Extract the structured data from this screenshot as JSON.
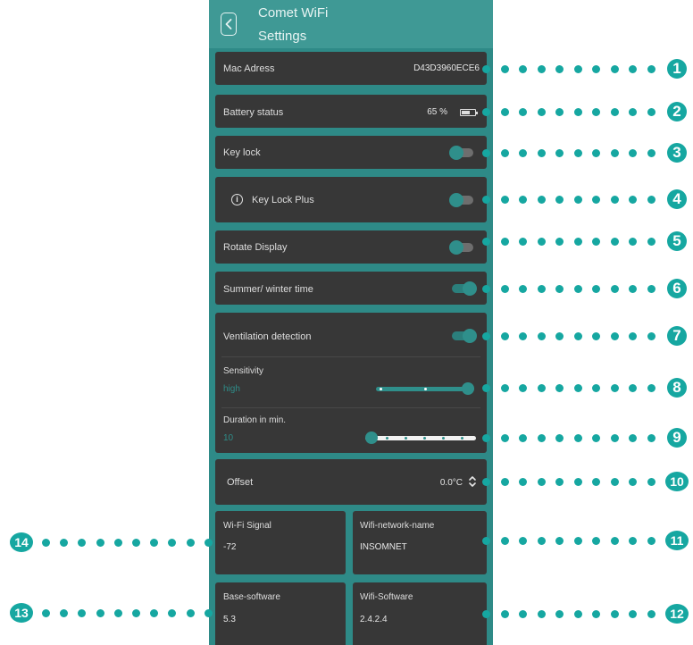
{
  "header": {
    "title_line1": "Comet WiFi",
    "title_line2": "Settings",
    "back_icon": "chevron-left-icon"
  },
  "mac": {
    "label": "Mac Adress",
    "value": "D43D3960ECE6"
  },
  "battery": {
    "label": "Battery status",
    "value": "65 %",
    "level_percent": 65
  },
  "key_lock": {
    "label": "Key lock",
    "on": false
  },
  "key_lock_plus": {
    "label": "Key Lock Plus",
    "icon": "info-icon",
    "on": false
  },
  "rotate_display": {
    "label": "Rotate Display",
    "on": false
  },
  "summer_winter": {
    "label": "Summer/ winter time",
    "on": true
  },
  "ventilation": {
    "label": "Ventilation detection",
    "on": true,
    "sensitivity": {
      "label": "Sensitivity",
      "value": "high",
      "level_fraction": 1.0
    },
    "duration": {
      "label": "Duration in min.",
      "value": "10",
      "level_fraction": 0.0
    }
  },
  "offset": {
    "label": "Offset",
    "value": "0.0°C",
    "icon": "up-down-icon"
  },
  "wifi_signal": {
    "label": "Wi-Fi Signal",
    "value": "-72"
  },
  "wifi_network": {
    "label": "Wifi-network-name",
    "value": "INSOMNET"
  },
  "base_software": {
    "label": "Base-software",
    "value": "5.3"
  },
  "wifi_software": {
    "label": "Wifi-Software",
    "value": "2.4.2.4"
  },
  "callouts": [
    "1",
    "2",
    "3",
    "4",
    "5",
    "6",
    "7",
    "8",
    "9",
    "10",
    "11",
    "12",
    "13",
    "14"
  ],
  "colors": {
    "accent": "#16a7a1",
    "panel_bg": "#2e8a87",
    "card_bg": "#373737",
    "toggle_on": "#2f8f8b"
  }
}
